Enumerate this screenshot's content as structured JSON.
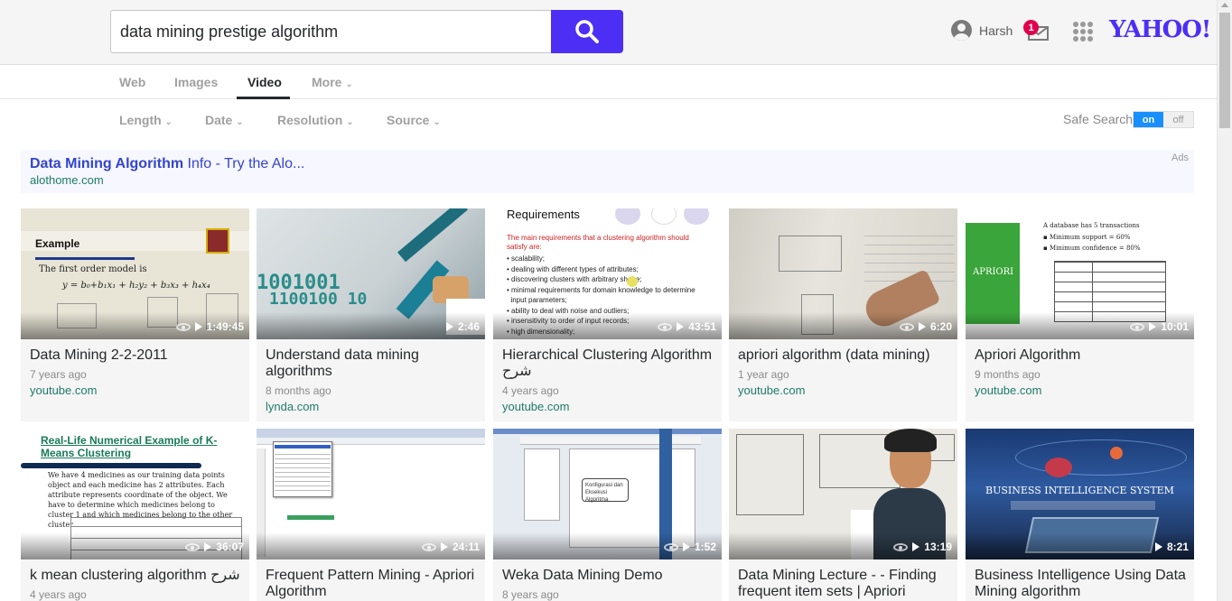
{
  "search": {
    "query": "data mining prestige algorithm"
  },
  "user": {
    "name": "Harsh",
    "mail_count": "1"
  },
  "logo": "YAHOO!",
  "tabs": [
    {
      "label": "Web"
    },
    {
      "label": "Images"
    },
    {
      "label": "Video"
    },
    {
      "label": "More"
    }
  ],
  "filters": [
    {
      "label": "Length"
    },
    {
      "label": "Date"
    },
    {
      "label": "Resolution"
    },
    {
      "label": "Source"
    }
  ],
  "safe_search": {
    "label": "Safe Search",
    "on": "on",
    "off": "off"
  },
  "ad": {
    "title_bold": "Data Mining Algorithm",
    "title_rest": " Info - Try the Alo...",
    "url": "alothome.com",
    "label": "Ads"
  },
  "videos": [
    {
      "title": "Data Mining 2-2-2011",
      "age": "7 years ago",
      "source": "youtube.com",
      "duration": "1:49:45",
      "eye": true
    },
    {
      "title": "Understand data mining algorithms",
      "age": "8 months ago",
      "source": "lynda.com",
      "duration": "2:46",
      "eye": false
    },
    {
      "title": "Hierarchical Clustering Algorithm شرح",
      "age": "4 years ago",
      "source": "youtube.com",
      "duration": "43:51",
      "eye": true
    },
    {
      "title": "apriori algorithm (data mining)",
      "age": "1 year ago",
      "source": "youtube.com",
      "duration": "6:20",
      "eye": true
    },
    {
      "title": "Apriori Algorithm",
      "age": "9 months ago",
      "source": "youtube.com",
      "duration": "10:01",
      "eye": true
    },
    {
      "title": "k mean clustering algorithm شرح",
      "age": "4 years ago",
      "source": "",
      "duration": "36:07",
      "eye": true
    },
    {
      "title": "Frequent Pattern Mining - Apriori Algorithm",
      "age": "",
      "source": "",
      "duration": "24:11",
      "eye": true
    },
    {
      "title": "Weka Data Mining Demo",
      "age": "8 years ago",
      "source": "",
      "duration": "1:52",
      "eye": true
    },
    {
      "title": "Data Mining Lecture - - Finding frequent item sets | Apriori",
      "age": "",
      "source": "",
      "duration": "13:19",
      "eye": true
    },
    {
      "title": "Business Intelligence Using Data Mining algorithm",
      "age": "",
      "source": "",
      "duration": "8:21",
      "eye": false
    }
  ],
  "thumb_text": {
    "t0_heading": "Example",
    "t0_line": "The first order model is",
    "t2_heading": "Requirements",
    "t2_sub": "The main requirements that a clustering algorithm should satisfy are:",
    "t4_label": "APRIORI",
    "t4_intro": "A database has 5 transactions",
    "t5_heading": "Real-Life Numerical Example of K-Means Clustering",
    "t9_heading": "BUSINESS INTELLIGENCE SYSTEM"
  }
}
